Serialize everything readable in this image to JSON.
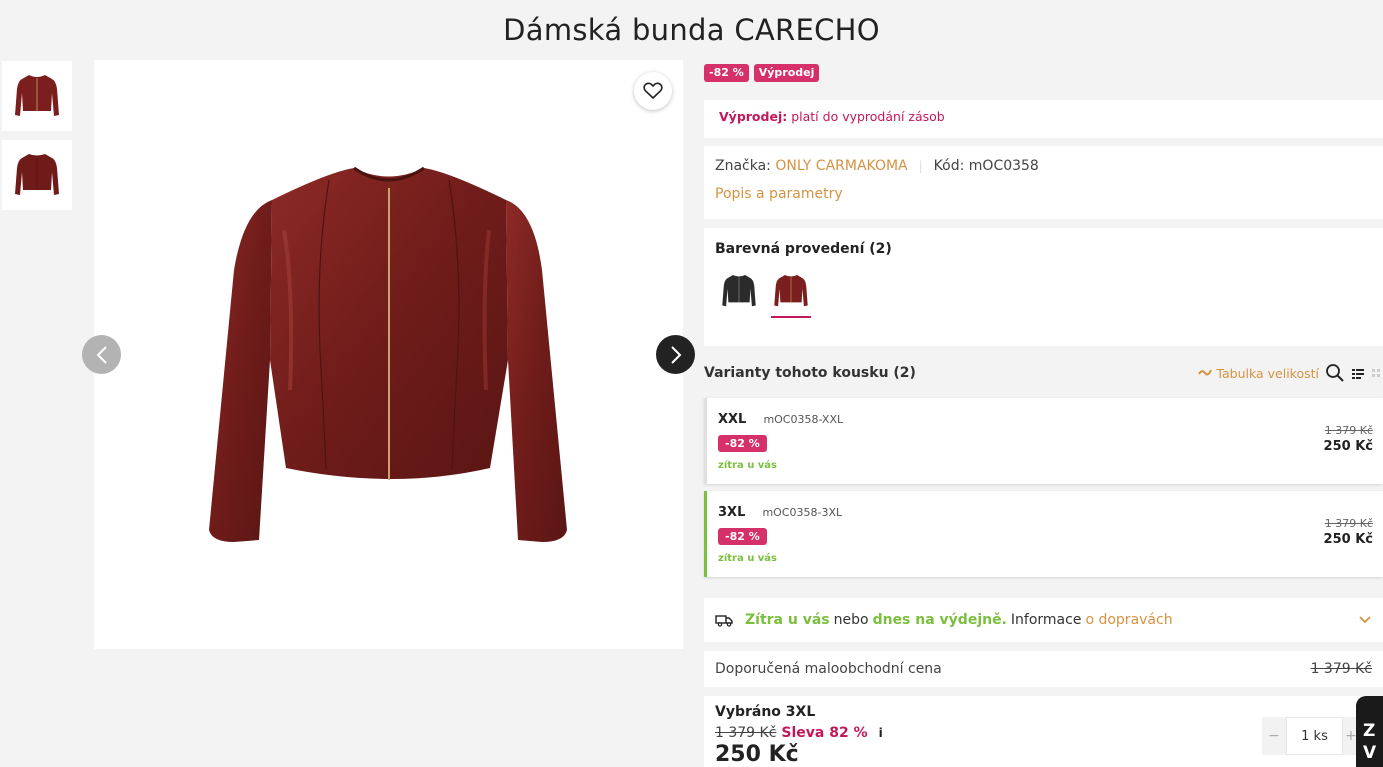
{
  "product": {
    "title": "Dámská bunda CARECHO"
  },
  "gallery": {
    "thumbnails": [
      "jacket-front-thumbnail",
      "jacket-back-thumbnail"
    ],
    "main_image": "red-leather-jacket",
    "favorite_icon": "heart-icon",
    "prev_icon": "chevron-left-icon",
    "next_icon": "chevron-right-icon"
  },
  "badges": [
    "-82 %",
    "Výprodej"
  ],
  "sale_notice": {
    "label": "Výprodej:",
    "text": "platí do vyprodání zásob"
  },
  "brand_info": {
    "brand_label": "Značka:",
    "brand": "ONLY CARMAKOMA",
    "code_label": "Kód:",
    "code": "mOC0358",
    "description_link": "Popis a parametry"
  },
  "colors": {
    "title": "Barevná provedení (2)",
    "items": [
      {
        "name": "black-variant",
        "color": "#2b2b2b"
      },
      {
        "name": "red-variant",
        "color": "#7a1f1d",
        "active": true
      }
    ]
  },
  "variants": {
    "title": "Varianty tohoto kousku (2)",
    "size_table_label": "Tabulka velikostí",
    "items": [
      {
        "size": "XXL",
        "code": "mOC0358-XXL",
        "discount": "-82 %",
        "availability": "zítra u vás",
        "old_price": "1 379 Kč",
        "price": "250 Kč"
      },
      {
        "size": "3XL",
        "code": "mOC0358-3XL",
        "discount": "-82 %",
        "availability": "zítra u vás",
        "old_price": "1 379 Kč",
        "price": "250 Kč"
      }
    ]
  },
  "delivery": {
    "part1": "Zítra u vás",
    "part2": "nebo",
    "part3": "dnes na výdejně.",
    "part4": "Informace",
    "link": "o dopravách"
  },
  "rrp": {
    "label": "Doporučená maloobchodní cena",
    "value": "1 379 Kč"
  },
  "selected": {
    "title": "Vybráno 3XL",
    "old_price": "1 379 Kč",
    "discount": "Sleva 82 %",
    "info": "i",
    "price": "250 Kč",
    "qty_minus": "−",
    "qty_value": "1 ks",
    "qty_plus": "+"
  },
  "chat": {
    "label": "Z\nV"
  },
  "theme": {
    "accent_pink": "#d5306a",
    "gold": "#d49342",
    "green": "#7bbf3f"
  }
}
